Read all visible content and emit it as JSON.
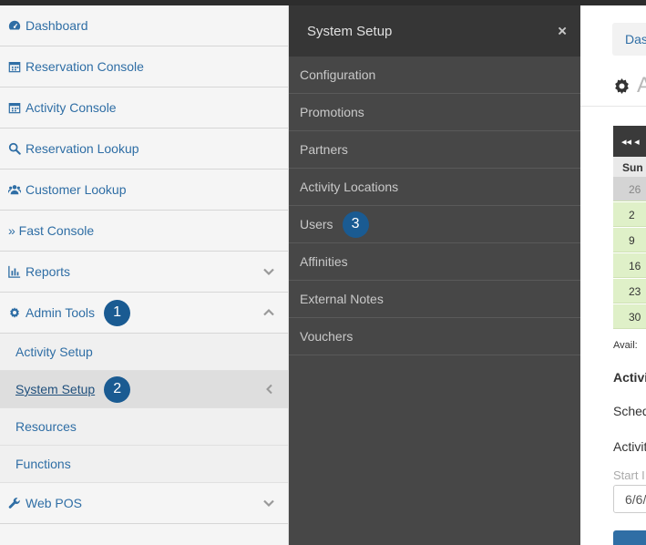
{
  "sidebar": {
    "items": [
      {
        "label": "Dashboard",
        "icon": "dashboard-icon"
      },
      {
        "label": "Reservation Console",
        "icon": "calendar-icon"
      },
      {
        "label": "Activity Console",
        "icon": "calendar-icon"
      },
      {
        "label": "Reservation Lookup",
        "icon": "search-icon"
      },
      {
        "label": "Customer Lookup",
        "icon": "users-icon"
      },
      {
        "label": "» Fast Console",
        "icon": ""
      },
      {
        "label": "Reports",
        "icon": "bar-chart-icon"
      },
      {
        "label": "Admin Tools",
        "icon": "gear-icon"
      }
    ],
    "admin_badge": "1",
    "sub_items": [
      {
        "label": "Activity Setup"
      },
      {
        "label": "System Setup"
      },
      {
        "label": "Resources"
      },
      {
        "label": "Functions"
      }
    ],
    "system_setup_badge": "2",
    "web_pos": {
      "label": "Web POS",
      "icon": "wrench-icon"
    }
  },
  "flyout": {
    "title": "System Setup",
    "close": "×",
    "items": [
      {
        "label": "Configuration"
      },
      {
        "label": "Promotions"
      },
      {
        "label": "Partners"
      },
      {
        "label": "Activity Locations"
      },
      {
        "label": "Users"
      },
      {
        "label": "Affinities"
      },
      {
        "label": "External Notes"
      },
      {
        "label": "Vouchers"
      }
    ],
    "users_badge": "3"
  },
  "content": {
    "breadcrumb": "Das",
    "title": "A",
    "calendar": {
      "nav": "◂◂ ◂",
      "dow": "Sun",
      "days": [
        "26",
        "2",
        "9",
        "16",
        "23",
        "30"
      ]
    },
    "avail_label": "Avail:",
    "section_label": "Activi",
    "schedule_label": "Sched",
    "activity_label": "Activit",
    "start_label": "Start I",
    "start_value": "6/6/"
  },
  "colors": {
    "link": "#2f6ea5",
    "badge": "#1a5b92",
    "flyout_bg": "#474747",
    "flyout_header": "#363636",
    "calendar_green": "#dff0c8"
  }
}
